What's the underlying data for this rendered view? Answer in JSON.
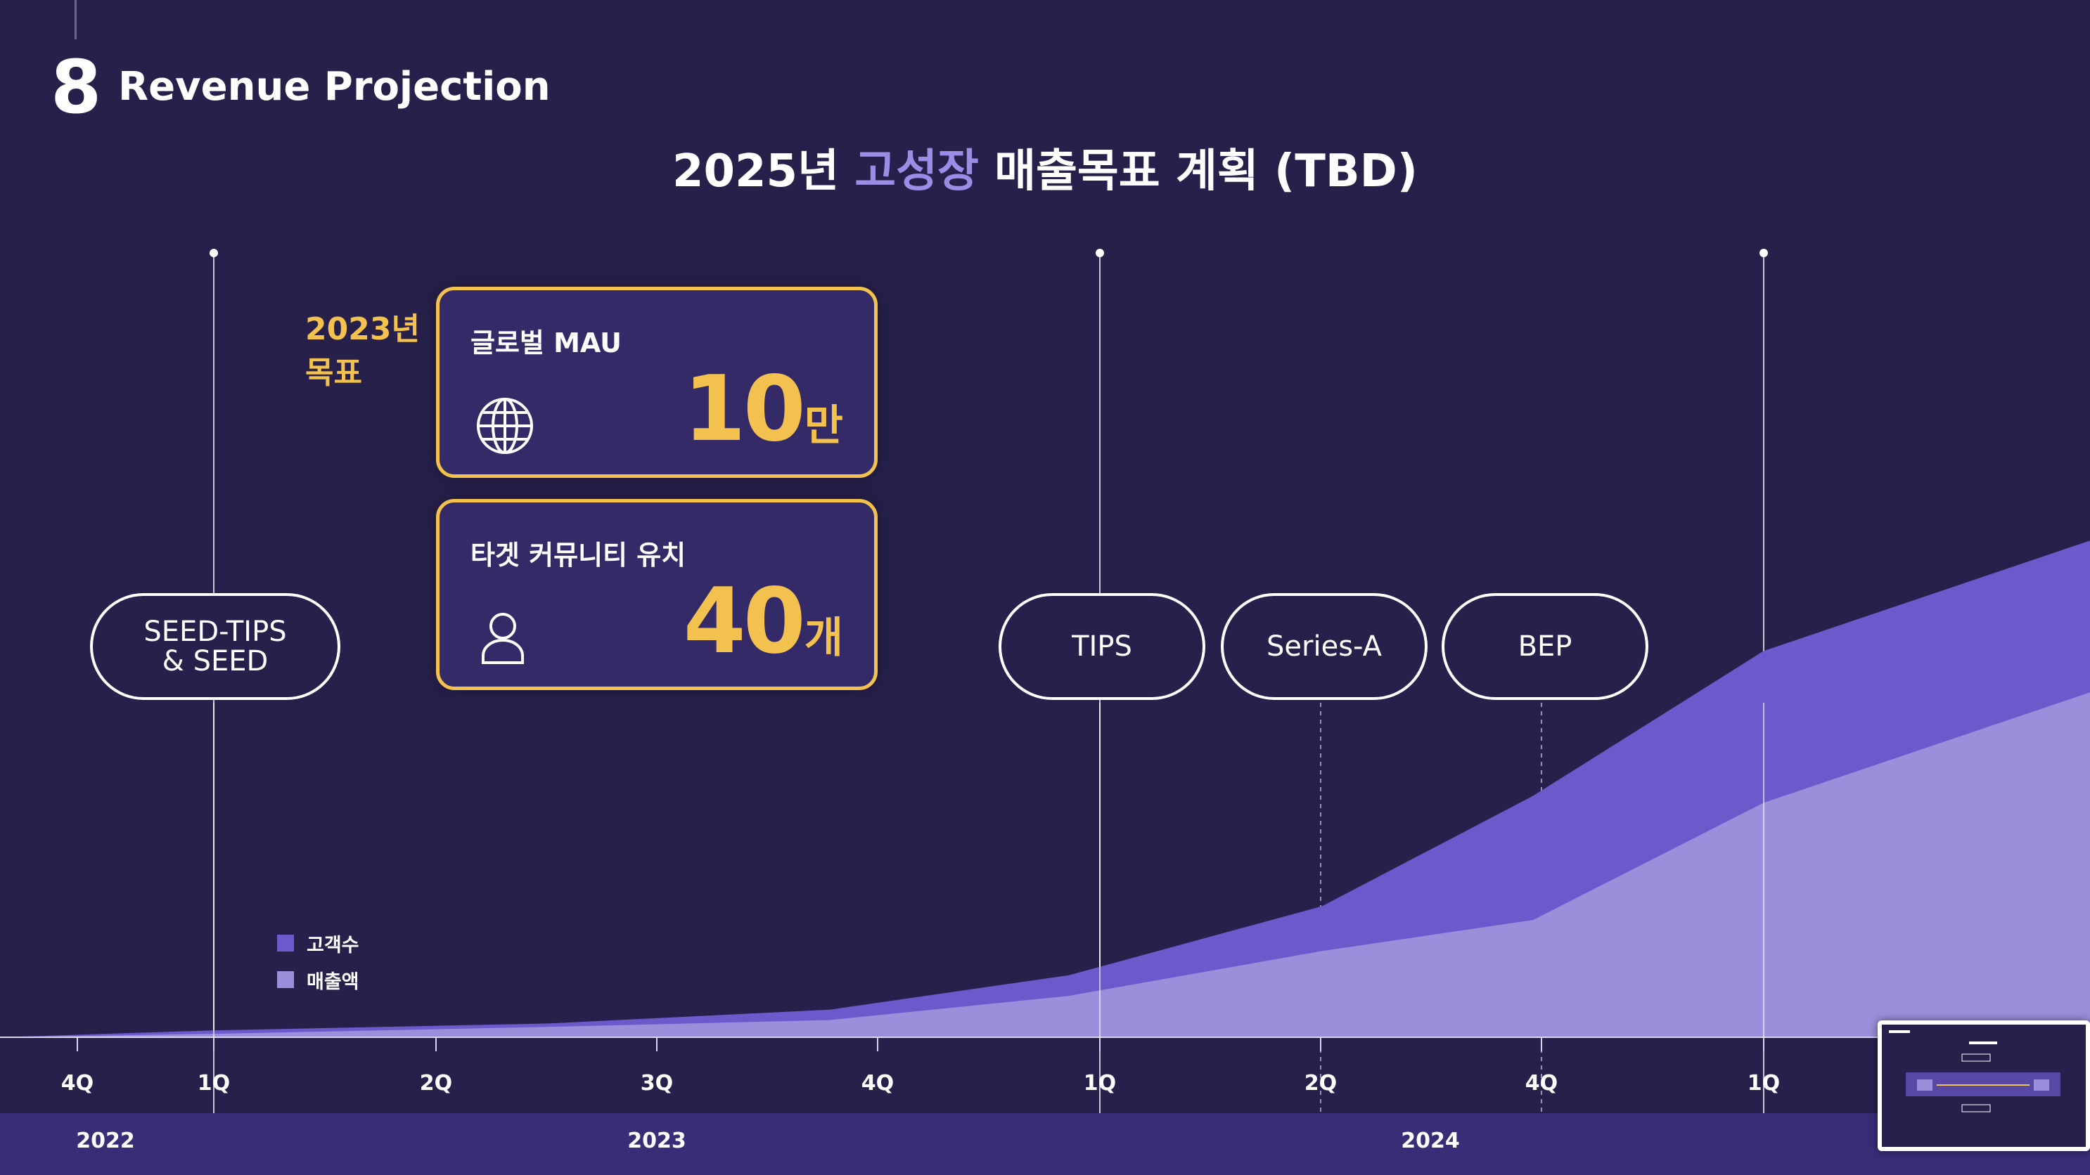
{
  "header": {
    "section_number": "8",
    "section_title": "Revenue Projection"
  },
  "headline": {
    "prefix": "2025년 ",
    "highlight": "고성장",
    "suffix": " 매출목표 계획 (TBD)",
    "highlight_color": "#9d8ce6"
  },
  "goal_label": {
    "line1": "2023년",
    "line2": "목표",
    "color": "#f2c14e"
  },
  "cards": [
    {
      "title": "글로벌 MAU",
      "icon": "globe-icon",
      "value": "10",
      "unit": "만"
    },
    {
      "title": "타겟 커뮤니티 유치",
      "icon": "person-icon",
      "value": "40",
      "unit": "개"
    }
  ],
  "milestones": [
    {
      "label_line1": "SEED-TIPS",
      "label_line2": "& SEED"
    },
    {
      "label_line1": "TIPS",
      "label_line2": ""
    },
    {
      "label_line1": "Series-A",
      "label_line2": ""
    },
    {
      "label_line1": "BEP",
      "label_line2": ""
    }
  ],
  "chart_data": {
    "type": "area",
    "title": "",
    "xlabel": "",
    "ylabel": "",
    "x": [
      "4Q",
      "1Q",
      "2Q",
      "3Q",
      "4Q",
      "1Q",
      "2Q",
      "4Q",
      "1Q"
    ],
    "years": [
      "2022",
      "2023",
      "2024"
    ],
    "grid": false,
    "legend": "bottom-left",
    "series": [
      {
        "name": "고객수",
        "color": "#6c5acd",
        "values": [
          0,
          1,
          2,
          4,
          9,
          19,
          35,
          56,
          72,
          128
        ]
      },
      {
        "name": "매출액",
        "color": "#9b8fdc",
        "values": [
          0,
          0.5,
          1.5,
          2.5,
          6,
          12.5,
          17,
          34,
          50,
          80
        ]
      }
    ]
  },
  "colors": {
    "background": "#27204b",
    "accent_gold": "#f2c14e",
    "card_background": "#342a67",
    "year_band": "#3a2d78"
  }
}
